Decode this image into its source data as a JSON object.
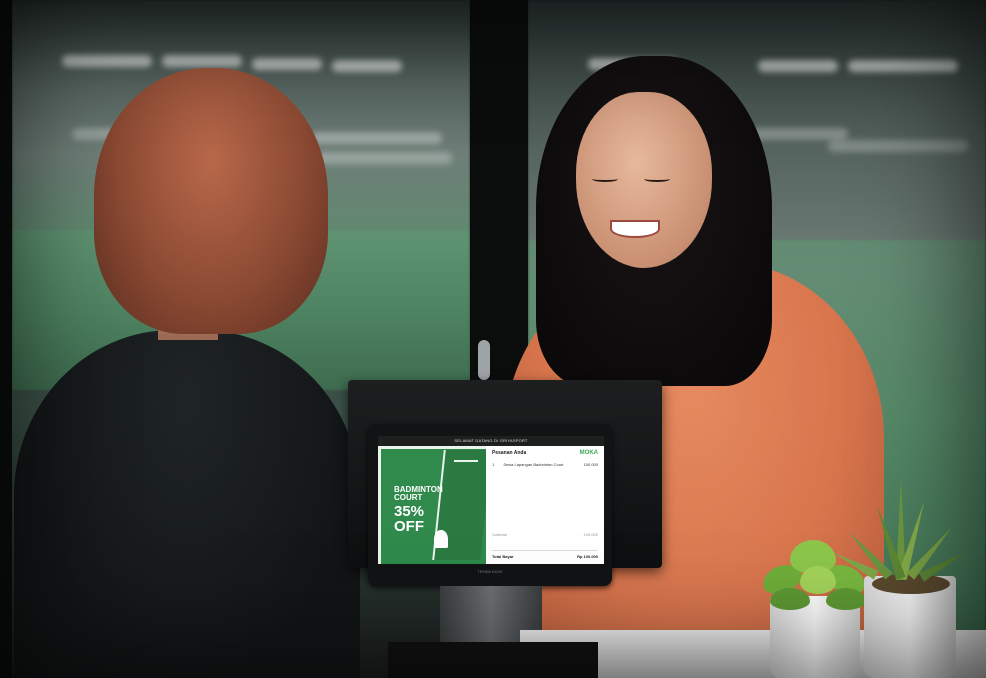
{
  "screen": {
    "header": "SELAMAT DATANG DI GRIYASPORT",
    "promo": {
      "line1": "BADMINTON",
      "line2": "COURT",
      "discount": "35%",
      "off": "OFF"
    },
    "order": {
      "title": "Pesanan Anda",
      "brand": "MOKA",
      "item_qty": "1",
      "item_name": "Sewa Lapangan Badminton Court",
      "item_price": "100.000",
      "subtotal_label": "Subtotal",
      "subtotal_value": "100.000",
      "total_label": "Total Bayar",
      "total_value": "Rp 100.000"
    },
    "footer": "TERIMA KASIH"
  },
  "colors": {
    "brand_green": "#3cab5a",
    "promo_green": "#2f8a4c",
    "blouse_orange": "#d8754d"
  }
}
